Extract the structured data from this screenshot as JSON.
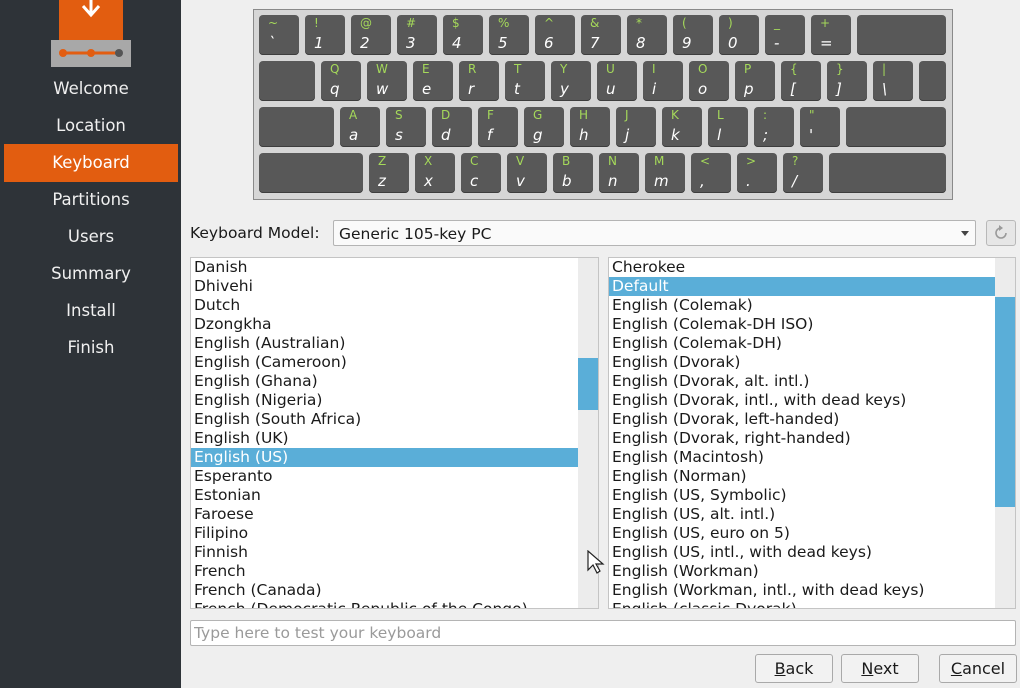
{
  "sidebar": {
    "items": [
      {
        "label": "Welcome"
      },
      {
        "label": "Location"
      },
      {
        "label": "Keyboard",
        "active": true
      },
      {
        "label": "Partitions"
      },
      {
        "label": "Users"
      },
      {
        "label": "Summary"
      },
      {
        "label": "Install"
      },
      {
        "label": "Finish"
      }
    ]
  },
  "keyboard_rows": [
    [
      [
        "~",
        "`"
      ],
      [
        "!",
        "1"
      ],
      [
        "@",
        "2"
      ],
      [
        "#",
        "3"
      ],
      [
        "$",
        "4"
      ],
      [
        "%",
        "5"
      ],
      [
        "^",
        "6"
      ],
      [
        "&",
        "7"
      ],
      [
        "*",
        "8"
      ],
      [
        "(",
        "9"
      ],
      [
        ")",
        "0"
      ],
      [
        "_",
        "-"
      ],
      [
        "+",
        "="
      ]
    ],
    [
      [
        "Q",
        "q"
      ],
      [
        "W",
        "w"
      ],
      [
        "E",
        "e"
      ],
      [
        "R",
        "r"
      ],
      [
        "T",
        "t"
      ],
      [
        "Y",
        "y"
      ],
      [
        "U",
        "u"
      ],
      [
        "I",
        "i"
      ],
      [
        "O",
        "o"
      ],
      [
        "P",
        "p"
      ],
      [
        "{",
        "["
      ],
      [
        "}",
        "]"
      ],
      [
        "|",
        "\\"
      ]
    ],
    [
      [
        "A",
        "a"
      ],
      [
        "S",
        "s"
      ],
      [
        "D",
        "d"
      ],
      [
        "F",
        "f"
      ],
      [
        "G",
        "g"
      ],
      [
        "H",
        "h"
      ],
      [
        "J",
        "j"
      ],
      [
        "K",
        "k"
      ],
      [
        "L",
        "l"
      ],
      [
        ":",
        ";"
      ],
      [
        "\"",
        "'"
      ]
    ],
    [
      [
        "Z",
        "z"
      ],
      [
        "X",
        "x"
      ],
      [
        "C",
        "c"
      ],
      [
        "V",
        "v"
      ],
      [
        "B",
        "b"
      ],
      [
        "N",
        "n"
      ],
      [
        "M",
        "m"
      ],
      [
        "<",
        ","
      ],
      [
        ">",
        "."
      ],
      [
        "?",
        "/"
      ]
    ]
  ],
  "model": {
    "label": "Keyboard Model:",
    "value": "Generic 105-key PC"
  },
  "layouts": {
    "items": [
      "Danish",
      "Dhivehi",
      "Dutch",
      "Dzongkha",
      "English (Australian)",
      "English (Cameroon)",
      "English (Ghana)",
      "English (Nigeria)",
      "English (South Africa)",
      "English (UK)",
      "English (US)",
      "Esperanto",
      "Estonian",
      "Faroese",
      "Filipino",
      "Finnish",
      "French",
      "French (Canada)",
      "French (Democratic Republic of the Congo)"
    ],
    "selected": "English (US)"
  },
  "variants": {
    "items": [
      "Cherokee",
      "Default",
      "English (Colemak)",
      "English (Colemak-DH ISO)",
      "English (Colemak-DH)",
      "English (Dvorak)",
      "English (Dvorak, alt. intl.)",
      "English (Dvorak, intl., with dead keys)",
      "English (Dvorak, left-handed)",
      "English (Dvorak, right-handed)",
      "English (Macintosh)",
      "English (Norman)",
      "English (US, Symbolic)",
      "English (US, alt. intl.)",
      "English (US, euro on 5)",
      "English (US, intl., with dead keys)",
      "English (Workman)",
      "English (Workman, intl., with dead keys)",
      "English (classic Dvorak)"
    ],
    "selected": "Default"
  },
  "test_input": {
    "placeholder": "Type here to test your keyboard",
    "value": ""
  },
  "buttons": {
    "back": {
      "pre": "",
      "u": "B",
      "post": "ack"
    },
    "next": {
      "pre": "",
      "u": "N",
      "post": "ext"
    },
    "cancel": {
      "pre": "",
      "u": "C",
      "post": "ancel"
    }
  },
  "colors": {
    "accent": "#e25d10",
    "selection": "#5aaed8",
    "sidebar": "#2e3338",
    "key": "#585858",
    "shift_label": "#a5d95a"
  }
}
